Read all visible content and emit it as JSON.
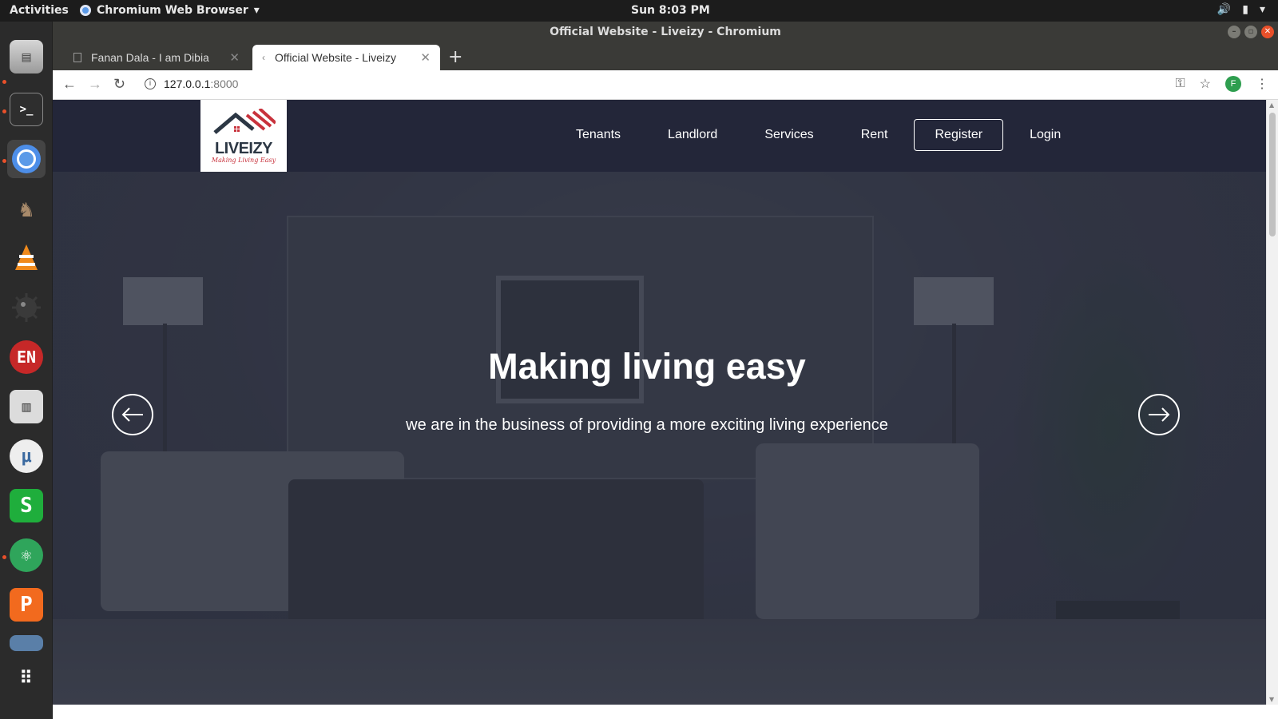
{
  "system": {
    "activities": "Activities",
    "app_menu": "Chromium Web Browser",
    "clock": "Sun  8:03 PM"
  },
  "window": {
    "title": "Official Website - Liveizy - Chromium"
  },
  "tabs": [
    {
      "title": "Fanan Dala - I am Dibia",
      "active": false
    },
    {
      "title": "Official Website - Liveizy",
      "active": true
    }
  ],
  "toolbar": {
    "url_host": "127.0.0.1",
    "url_port": ":8000",
    "profile_initial": "F"
  },
  "dock": {
    "items": [
      {
        "name": "files-icon",
        "running": true
      },
      {
        "name": "terminal-icon",
        "running": true
      },
      {
        "name": "chromium-icon",
        "running": true,
        "active": true
      },
      {
        "name": "gimp-icon",
        "running": false
      },
      {
        "name": "vlc-icon",
        "running": false
      },
      {
        "name": "mines-icon",
        "running": false
      },
      {
        "name": "dictionary-icon",
        "running": false
      },
      {
        "name": "mixer-icon",
        "running": false
      },
      {
        "name": "mu-editor-icon",
        "running": false
      },
      {
        "name": "spreadsheet-icon",
        "running": false
      },
      {
        "name": "atom-icon",
        "running": true
      },
      {
        "name": "presentation-icon",
        "running": false
      },
      {
        "name": "folder-icon",
        "running": false
      },
      {
        "name": "show-apps-icon",
        "running": false
      }
    ]
  },
  "site": {
    "logo": {
      "name": "LIVEIZY",
      "tagline": "Making Living Easy"
    },
    "nav": [
      "Tenants",
      "Landlord",
      "Services",
      "Rent"
    ],
    "register_label": "Register",
    "login_label": "Login",
    "hero_title": "Making living easy",
    "hero_subtitle": "we are in the business of providing a more exciting living experience"
  },
  "colors": {
    "navbar_bg": "#232639",
    "brand_red": "#c8323c",
    "brand_dark": "#2c3744"
  }
}
